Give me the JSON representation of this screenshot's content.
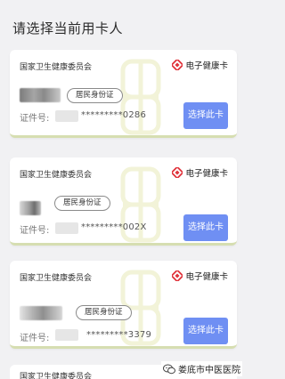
{
  "page": {
    "title": "请选择当前用卡人"
  },
  "cards": [
    {
      "org": "国家卫生健康委员会",
      "brand": "电子健康卡",
      "id_type": "居民身份证",
      "id_label": "证件号:",
      "id_masked": "*********0286",
      "button": "选择此卡"
    },
    {
      "org": "国家卫生健康委员会",
      "brand": "电子健康卡",
      "id_type": "居民身份证",
      "id_label": "证件号:",
      "id_masked": "*********002X",
      "button": "选择此卡"
    },
    {
      "org": "国家卫生健康委员会",
      "brand": "电子健康卡",
      "id_type": "居民身份证",
      "id_label": "证件号:",
      "id_masked": "*********3379",
      "button": "选择此卡"
    }
  ],
  "partial_card": {
    "org": "国家卫生健康委员会"
  },
  "watermark": {
    "text": "娄底市中医医院"
  },
  "colors": {
    "button": "#6f8ff3",
    "brand_logo": "#e0343c",
    "card_border": "#d6deb1"
  }
}
